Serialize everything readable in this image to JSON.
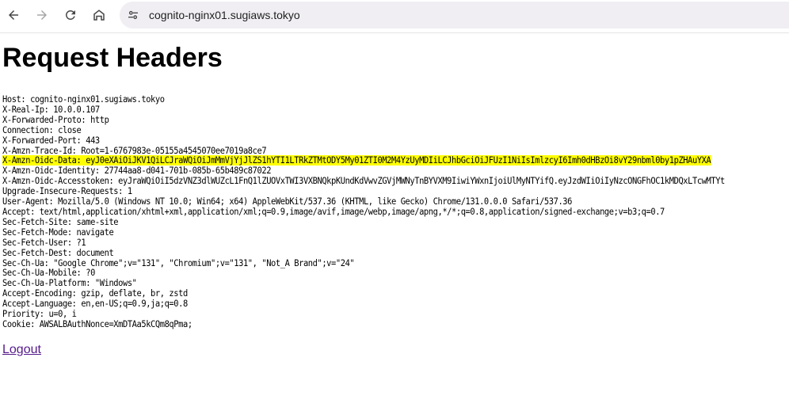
{
  "browser": {
    "url": "cognito-nginx01.sugiaws.tokyo"
  },
  "page": {
    "title": "Request Headers",
    "headers": [
      "Host: cognito-nginx01.sugiaws.tokyo",
      "X-Real-Ip: 10.0.0.107",
      "X-Forwarded-Proto: http",
      "Connection: close",
      "X-Forwarded-Port: 443",
      "X-Amzn-Trace-Id: Root=1-6767983e-05155a4545070ee7019a8ce7",
      "X-Amzn-Oidc-Data: eyJ0eXAiOiJKV1QiLCJraWQiOiJmMmVjYjJlZS1hYTI1LTRkZTMtODY5My01ZTI0M2M4YzUyMDIiLCJhbGciOiJFUzI1NiIsImlzcyI6Imh0dHBzOi8vY29nbml0by1pZHAuYXA",
      "X-Amzn-Oidc-Identity: 27744aa8-d041-701b-085b-65b489c87022",
      "X-Amzn-Oidc-Accesstoken: eyJraWQiOiI5dzVNZ3dlWUZcL1FnQ1lZUOVxTWI3VXBNQkpKUndKdVwvZGVjMWNyTnBYVXM9IiwiYWxnIjoiUlMyNTYifQ.eyJzdWIiOiIyNzcONGFhOC1kMDQxLTcwMTYt",
      "Upgrade-Insecure-Requests: 1",
      "User-Agent: Mozilla/5.0 (Windows NT 10.0; Win64; x64) AppleWebKit/537.36 (KHTML, like Gecko) Chrome/131.0.0.0 Safari/537.36",
      "Accept: text/html,application/xhtml+xml,application/xml;q=0.9,image/avif,image/webp,image/apng,*/*;q=0.8,application/signed-exchange;v=b3;q=0.7",
      "Sec-Fetch-Site: same-site",
      "Sec-Fetch-Mode: navigate",
      "Sec-Fetch-User: ?1",
      "Sec-Fetch-Dest: document",
      "Sec-Ch-Ua: \"Google Chrome\";v=\"131\", \"Chromium\";v=\"131\", \"Not_A Brand\";v=\"24\"",
      "Sec-Ch-Ua-Mobile: ?0",
      "Sec-Ch-Ua-Platform: \"Windows\"",
      "Accept-Encoding: gzip, deflate, br, zstd",
      "Accept-Language: en,en-US;q=0.9,ja;q=0.8",
      "Priority: u=0, i",
      "Cookie: AWSALBAuthNonce=XmDTAa5kCQm8qPma;"
    ],
    "highlighted_index": 6,
    "logout_label": "Logout"
  },
  "colors": {
    "highlight": "#ffff00",
    "link_visited": "#551a8b",
    "omnibox_bg": "#f0eef3"
  },
  "icons": {
    "back": "arrow-left-icon",
    "forward": "arrow-right-icon",
    "reload": "reload-icon",
    "home": "home-icon",
    "site_info": "tune-icon"
  }
}
